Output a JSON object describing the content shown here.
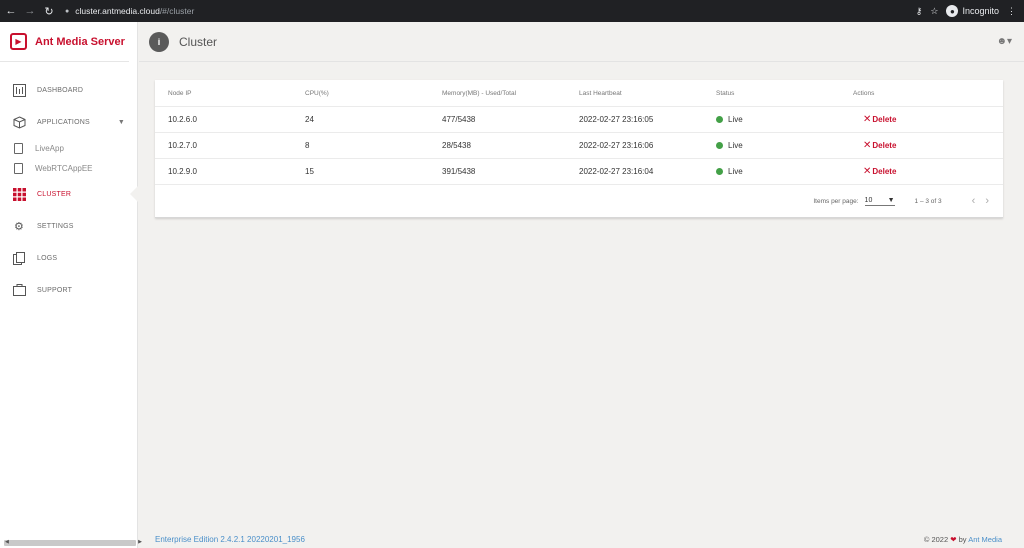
{
  "browser": {
    "url_host": "cluster.antmedia.cloud",
    "url_path": "/#/cluster",
    "incognito_label": "Incognito"
  },
  "sidebar": {
    "brand": "Ant Media Server",
    "items": [
      {
        "label": "DASHBOARD",
        "icon": "dashboard-icon"
      },
      {
        "label": "APPLICATIONS",
        "icon": "applications-icon"
      },
      {
        "label": "CLUSTER",
        "icon": "cluster-icon"
      },
      {
        "label": "SETTINGS",
        "icon": "settings-icon"
      },
      {
        "label": "LOGS",
        "icon": "logs-icon"
      },
      {
        "label": "SUPPORT",
        "icon": "support-icon"
      }
    ],
    "apps": [
      "LiveApp",
      "WebRTCAppEE"
    ]
  },
  "header": {
    "title": "Cluster"
  },
  "table": {
    "columns": [
      "Node IP",
      "CPU(%)",
      "Memory(MB) - Used/Total",
      "Last Heartbeat",
      "Status",
      "Actions"
    ],
    "rows": [
      {
        "ip": "10.2.6.0",
        "cpu": "24",
        "memory": "477/5438",
        "heartbeat": "2022-02-27 23:16:05",
        "status": "Live",
        "action": "Delete"
      },
      {
        "ip": "10.2.7.0",
        "cpu": "8",
        "memory": "28/5438",
        "heartbeat": "2022-02-27 23:16:06",
        "status": "Live",
        "action": "Delete"
      },
      {
        "ip": "10.2.9.0",
        "cpu": "15",
        "memory": "391/5438",
        "heartbeat": "2022-02-27 23:16:04",
        "status": "Live",
        "action": "Delete"
      }
    ],
    "pager": {
      "items_per_page_label": "Items per page:",
      "items_per_page": "10",
      "range": "1 – 3 of 3"
    }
  },
  "footer": {
    "edition": "Enterprise Edition 2.4.2.1 20220201_1956",
    "copyright": "© 2022",
    "by": "by",
    "company": "Ant Media"
  },
  "colors": {
    "brand": "#c8102e",
    "live": "#43a047",
    "link": "#4a8fc9"
  }
}
